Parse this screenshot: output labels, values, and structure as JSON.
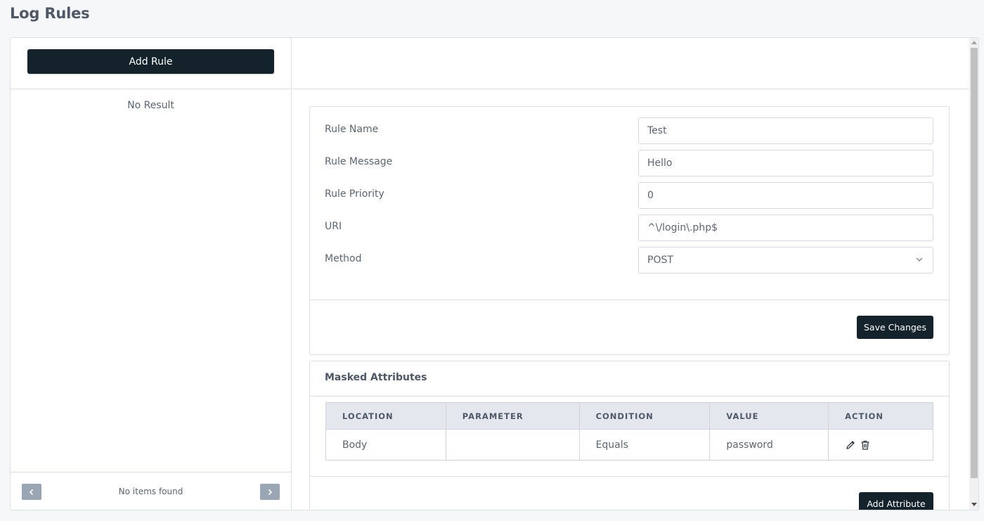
{
  "page": {
    "title": "Log Rules"
  },
  "sidebar": {
    "add_rule_label": "Add Rule",
    "empty_text": "No Result",
    "pagination": {
      "status": "No items found",
      "prev_icon": "chevron-left-icon",
      "next_icon": "chevron-right-icon"
    }
  },
  "rule_form": {
    "fields": [
      {
        "label": "Rule Name",
        "value": "Test"
      },
      {
        "label": "Rule Message",
        "value": "Hello"
      },
      {
        "label": "Rule Priority",
        "value": "0"
      },
      {
        "label": "URI",
        "value": "^\\/login\\.php$"
      },
      {
        "label": "Method",
        "value": "POST"
      }
    ],
    "save_label": "Save Changes"
  },
  "masked_attributes": {
    "title": "Masked Attributes",
    "columns": [
      "LOCATION",
      "PARAMETER",
      "CONDITION",
      "VALUE",
      "ACTION"
    ],
    "rows": [
      {
        "location": "Body",
        "parameter": "",
        "condition": "Equals",
        "value": "password",
        "actions": [
          "pencil-icon",
          "trash-icon"
        ]
      }
    ],
    "add_label": "Add Attribute"
  },
  "colors": {
    "primary_button": "#14222b",
    "pagination_button": "#9aa6b4",
    "table_header": "#e4e8ee"
  }
}
